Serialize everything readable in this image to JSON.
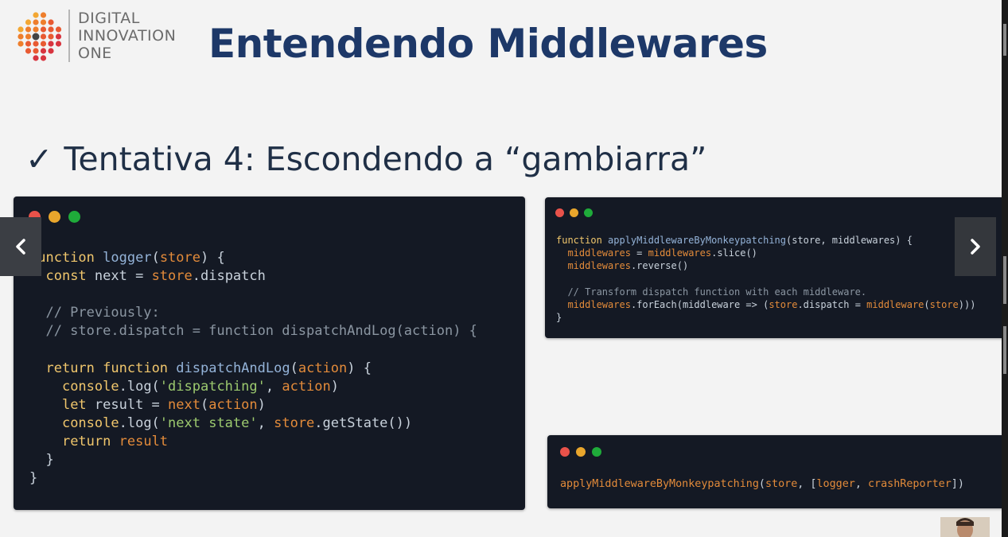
{
  "logo": {
    "lines": [
      "DIGITAL",
      "INNOVATION",
      "ONE"
    ],
    "icon": "dots-logo-icon"
  },
  "slide": {
    "title": "Entendendo Middlewares",
    "subtitle": "Tentativa 4: Escondendo a “gambiarra”",
    "check_icon": "check-icon"
  },
  "colors": {
    "title": "#1d3868",
    "code_background": "#141924",
    "keyword": "#f0c66c",
    "function_name": "#94b3d8",
    "string": "#9cc96e",
    "variable": "#e38b3a",
    "comment": "#8b96a2",
    "dot_red": "#e9524a",
    "dot_yellow": "#e9a62c",
    "dot_green": "#1fab3a"
  },
  "code_main": {
    "lines": [
      [
        [
          "kw",
          "function"
        ],
        [
          "pl",
          " "
        ],
        [
          "fn",
          "logger"
        ],
        [
          "pl",
          "("
        ],
        [
          "var",
          "store"
        ],
        [
          "pl",
          ") {"
        ]
      ],
      [
        [
          "pl",
          "  "
        ],
        [
          "kw",
          "const"
        ],
        [
          "pl",
          " next = "
        ],
        [
          "var",
          "store"
        ],
        [
          "pl",
          ".dispatch"
        ]
      ],
      [],
      [
        [
          "com",
          "  // Previously:"
        ]
      ],
      [
        [
          "com",
          "  // store.dispatch = function dispatchAndLog(action) {"
        ]
      ],
      [],
      [
        [
          "pl",
          "  "
        ],
        [
          "kw",
          "return"
        ],
        [
          "pl",
          " "
        ],
        [
          "kw",
          "function"
        ],
        [
          "pl",
          " "
        ],
        [
          "fn",
          "dispatchAndLog"
        ],
        [
          "pl",
          "("
        ],
        [
          "var",
          "action"
        ],
        [
          "pl",
          ") {"
        ]
      ],
      [
        [
          "pl",
          "    "
        ],
        [
          "kw",
          "console"
        ],
        [
          "pl",
          ".log("
        ],
        [
          "str",
          "'dispatching'"
        ],
        [
          "pl",
          ", "
        ],
        [
          "var",
          "action"
        ],
        [
          "pl",
          ")"
        ]
      ],
      [
        [
          "pl",
          "    "
        ],
        [
          "kw",
          "let"
        ],
        [
          "pl",
          " result = "
        ],
        [
          "var",
          "next"
        ],
        [
          "pl",
          "("
        ],
        [
          "var",
          "action"
        ],
        [
          "pl",
          ")"
        ]
      ],
      [
        [
          "pl",
          "    "
        ],
        [
          "kw",
          "console"
        ],
        [
          "pl",
          ".log("
        ],
        [
          "str",
          "'next state'"
        ],
        [
          "pl",
          ", "
        ],
        [
          "var",
          "store"
        ],
        [
          "pl",
          ".getState())"
        ]
      ],
      [
        [
          "pl",
          "    "
        ],
        [
          "kw",
          "return"
        ],
        [
          "pl",
          " "
        ],
        [
          "var",
          "result"
        ]
      ],
      [
        [
          "pl",
          "  }"
        ]
      ],
      [
        [
          "pl",
          "}"
        ]
      ]
    ]
  },
  "code_apply": {
    "lines": [
      [
        [
          "kw",
          "function"
        ],
        [
          "pl",
          " "
        ],
        [
          "fn",
          "applyMiddlewareByMonkeypatching"
        ],
        [
          "pl",
          "(store, middlewares) {"
        ]
      ],
      [
        [
          "pl",
          "  "
        ],
        [
          "var",
          "middlewares"
        ],
        [
          "pl",
          " = "
        ],
        [
          "var",
          "middlewares"
        ],
        [
          "pl",
          ".slice()"
        ]
      ],
      [
        [
          "pl",
          "  "
        ],
        [
          "var",
          "middlewares"
        ],
        [
          "pl",
          ".reverse()"
        ]
      ],
      [],
      [
        [
          "com",
          "  // Transform dispatch function with each middleware."
        ]
      ],
      [
        [
          "pl",
          "  "
        ],
        [
          "var",
          "middlewares"
        ],
        [
          "pl",
          ".forEach(middleware => ("
        ],
        [
          "var",
          "store"
        ],
        [
          "pl",
          ".dispatch = "
        ],
        [
          "var",
          "middleware"
        ],
        [
          "pl",
          "("
        ],
        [
          "var",
          "store"
        ],
        [
          "pl",
          ")))"
        ]
      ],
      [
        [
          "pl",
          "}"
        ]
      ]
    ]
  },
  "code_usage": {
    "lines": [
      [
        [
          "var",
          "applyMiddlewareByMonkeypatching"
        ],
        [
          "pl",
          "("
        ],
        [
          "var",
          "store"
        ],
        [
          "pl",
          ", ["
        ],
        [
          "var",
          "logger"
        ],
        [
          "pl",
          ", "
        ],
        [
          "var",
          "crashReporter"
        ],
        [
          "pl",
          "])"
        ]
      ]
    ]
  },
  "nav": {
    "prev_icon": "chevron-left-icon",
    "next_icon": "chevron-right-icon"
  }
}
